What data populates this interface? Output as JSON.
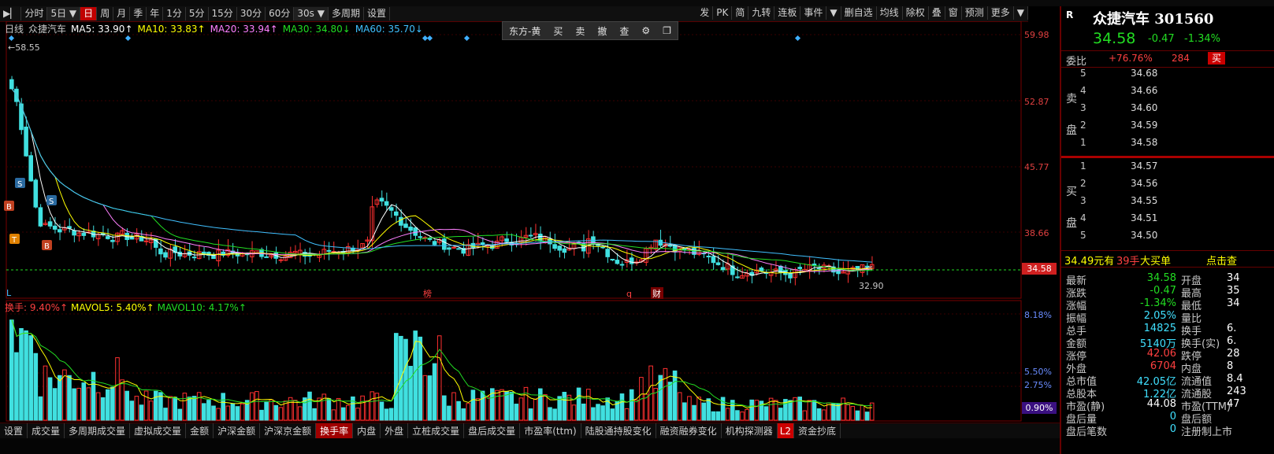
{
  "toolbar": {
    "items": [
      {
        "label": "分时",
        "active": false
      },
      {
        "label": "5日",
        "active": false,
        "dropdown": true
      },
      {
        "label": "日",
        "active": true
      },
      {
        "label": "周",
        "active": false
      },
      {
        "label": "月",
        "active": false
      },
      {
        "label": "季",
        "active": false
      },
      {
        "label": "年",
        "active": false
      },
      {
        "label": "1分",
        "active": false
      },
      {
        "label": "5分",
        "active": false
      },
      {
        "label": "15分",
        "active": false
      },
      {
        "label": "30分",
        "active": false
      },
      {
        "label": "60分",
        "active": false
      },
      {
        "label": "30s",
        "active": false,
        "dropdown": true
      },
      {
        "label": "多周期",
        "active": false
      },
      {
        "label": "设置",
        "active": false
      }
    ],
    "right_items": [
      "发",
      "PK",
      "简",
      "九转",
      "连板",
      "事件",
      "▼",
      "删自选",
      "均线",
      "除权",
      "叠",
      "窗",
      "预测",
      "更多",
      "▼"
    ]
  },
  "chart": {
    "legend": [
      {
        "text": "日线",
        "color": "#c8c8c8"
      },
      {
        "text": "众捷汽车",
        "color": "#c8c8c8"
      },
      {
        "text": "MA5: 33.90↑",
        "color": "#ffffff"
      },
      {
        "text": "MA10: 33.83↑",
        "color": "#ffff00"
      },
      {
        "text": "MA20: 33.94↑",
        "color": "#ff80ff"
      },
      {
        "text": "MA30: 34.80↓",
        "color": "#22dd22"
      },
      {
        "text": "MA60: 35.70↓",
        "color": "#40c0ff"
      }
    ],
    "vol_legend": [
      {
        "text": "换手: 9.40%↑",
        "color": "#ff4040"
      },
      {
        "text": "MAVOL5: 5.40%↑",
        "color": "#ffff00"
      },
      {
        "text": "MAVOL10: 4.17%↑",
        "color": "#22dd22"
      }
    ],
    "trade_buttons": [
      "东方-黄",
      "买",
      "卖",
      "撤",
      "查"
    ],
    "price_axis": [
      "59.98",
      "52.87",
      "45.77",
      "38.66",
      "34.58"
    ],
    "vol_axis": [
      "8.18%",
      "5.50%",
      "2.75%",
      "0.90%"
    ],
    "high_label": "←58.55",
    "low_label": "32.90",
    "markers": [
      "榜",
      "q",
      "财"
    ],
    "signal_labels": [
      "S",
      "B",
      "T",
      "S",
      "B"
    ],
    "left_corner": "L",
    "colors": {
      "up": "#ff3030",
      "down": "#40e0e0",
      "ma5": "#ffffff",
      "ma10": "#ffff00",
      "ma20": "#ff80ff",
      "ma30": "#22dd22",
      "ma60": "#40c0ff"
    }
  },
  "tabs": [
    "设置",
    "成交量",
    "多周期成交量",
    "虚拟成交量",
    "金额",
    "沪深金额",
    "沪深京金额",
    "换手率",
    "内盘",
    "外盘",
    "立桩成交量",
    "盘后成交量",
    "市盈率(ttm)",
    "陆股通持股变化",
    "融资融券变化",
    "机构探测器",
    "L2",
    "资金抄底"
  ],
  "active_tab": "换手率",
  "quote": {
    "r_mark": "R",
    "name": "众捷汽车 301560",
    "price": "34.58",
    "change": "-0.47",
    "change_pct": "-1.34%",
    "weibi_label": "委比",
    "weibi": "+76.76%",
    "weicha": "284",
    "buy_btn": "买",
    "sell_label": "卖盘",
    "buy_label": "买盘",
    "asks": [
      {
        "n": "5",
        "p": "34.68"
      },
      {
        "n": "4",
        "p": "34.66"
      },
      {
        "n": "3",
        "p": "34.60"
      },
      {
        "n": "2",
        "p": "34.59"
      },
      {
        "n": "1",
        "p": "34.58"
      }
    ],
    "bids": [
      {
        "n": "1",
        "p": "34.57"
      },
      {
        "n": "2",
        "p": "34.56"
      },
      {
        "n": "3",
        "p": "34.55"
      },
      {
        "n": "4",
        "p": "34.51"
      },
      {
        "n": "5",
        "p": "34.50"
      }
    ],
    "big_order": {
      "price": "34.49元有",
      "qty": "39手",
      "text": "大买单",
      "link": "点击查"
    },
    "stats": [
      {
        "k": "最新",
        "v": "34.58",
        "vc": "green",
        "k2": "开盘",
        "v2": "34"
      },
      {
        "k": "涨跌",
        "v": "-0.47",
        "vc": "green",
        "k2": "最高",
        "v2": "35"
      },
      {
        "k": "涨幅",
        "v": "-1.34%",
        "vc": "green",
        "k2": "最低",
        "v2": "34"
      },
      {
        "k": "振幅",
        "v": "2.05%",
        "vc": "cyan",
        "k2": "量比",
        "v2": ""
      },
      {
        "k": "总手",
        "v": "14825",
        "vc": "cyan",
        "k2": "换手",
        "v2": "6."
      },
      {
        "k": "金额",
        "v": "5140万",
        "vc": "cyan",
        "k2": "换手(实)",
        "v2": "6."
      },
      {
        "k": "涨停",
        "v": "42.06",
        "vc": "red",
        "k2": "跌停",
        "v2": "28"
      },
      {
        "k": "外盘",
        "v": "6704",
        "vc": "red",
        "k2": "内盘",
        "v2": "8"
      },
      {
        "k": "总市值",
        "v": "42.05亿",
        "vc": "cyan",
        "k2": "流通值",
        "v2": "8.4"
      },
      {
        "k": "总股本",
        "v": "1.22亿",
        "vc": "cyan",
        "k2": "流通股",
        "v2": "243"
      },
      {
        "k": "市盈(静)",
        "v": "44.08",
        "vc": "white",
        "k2": "市盈(TTM)",
        "v2": "47"
      },
      {
        "k": "盘后量",
        "v": "0",
        "vc": "cyan",
        "k2": "盘后额",
        "v2": ""
      },
      {
        "k": "盘后笔数",
        "v": "0",
        "vc": "cyan",
        "k2": "注册制上市",
        "v2": ""
      }
    ]
  }
}
